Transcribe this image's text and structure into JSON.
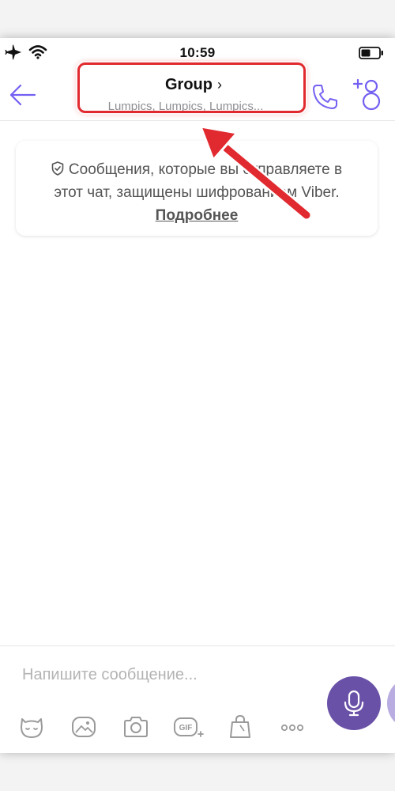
{
  "status_bar": {
    "time": "10:59",
    "icons": [
      "airplane-icon",
      "wifi-icon",
      "battery-icon"
    ]
  },
  "header": {
    "title": "Group",
    "title_chevron": "›",
    "participants": "Lumpics, Lumpics, Lumpics..."
  },
  "notice": {
    "text": "Сообщения, которые вы отправляете в этот чат, защищены шифрованием Viber.",
    "link": "Подробнее"
  },
  "composer": {
    "placeholder": "Напишите сообщение...",
    "tools": [
      "sticker-icon",
      "gallery-icon",
      "camera-icon",
      "gif-icon",
      "shop-icon",
      "more-icon"
    ]
  },
  "colors": {
    "accent": "#7360f2",
    "mic_button": "#6a51a8",
    "annotation": "#e12a2f"
  }
}
